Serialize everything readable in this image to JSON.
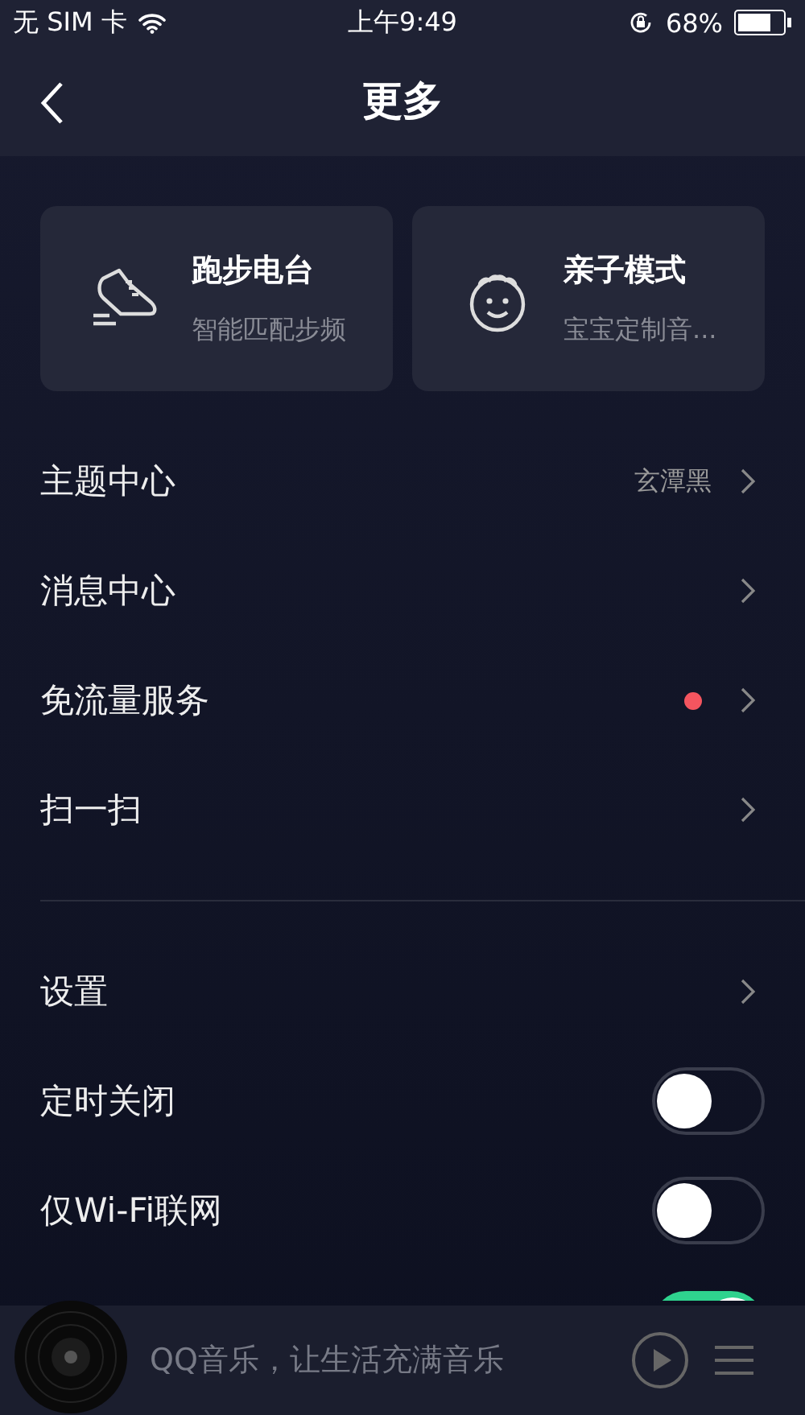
{
  "status_bar": {
    "carrier": "无 SIM 卡",
    "time": "上午9:49",
    "battery": "68%"
  },
  "nav": {
    "title": "更多"
  },
  "cards": [
    {
      "kind": "shoe",
      "title": "跑步电台",
      "subtitle": "智能匹配步频"
    },
    {
      "kind": "face",
      "title": "亲子模式",
      "subtitle": "宝宝定制音..."
    }
  ],
  "sections": [
    [
      {
        "kind": "link",
        "label": "主题中心",
        "value": "玄潭黑",
        "dot": false
      },
      {
        "kind": "link",
        "label": "消息中心",
        "dot": false
      },
      {
        "kind": "link",
        "label": "免流量服务",
        "dot": true
      },
      {
        "kind": "link",
        "label": "扫一扫",
        "dot": false
      }
    ],
    [
      {
        "kind": "link",
        "label": "设置",
        "dot": false
      },
      {
        "kind": "toggle",
        "label": "定时关闭",
        "on": false
      },
      {
        "kind": "toggle",
        "label": "仅Wi-Fi联网",
        "on": false
      },
      {
        "kind": "toggle",
        "on": true
      }
    ]
  ],
  "player": {
    "text": "QQ音乐，让生活充满音乐"
  }
}
